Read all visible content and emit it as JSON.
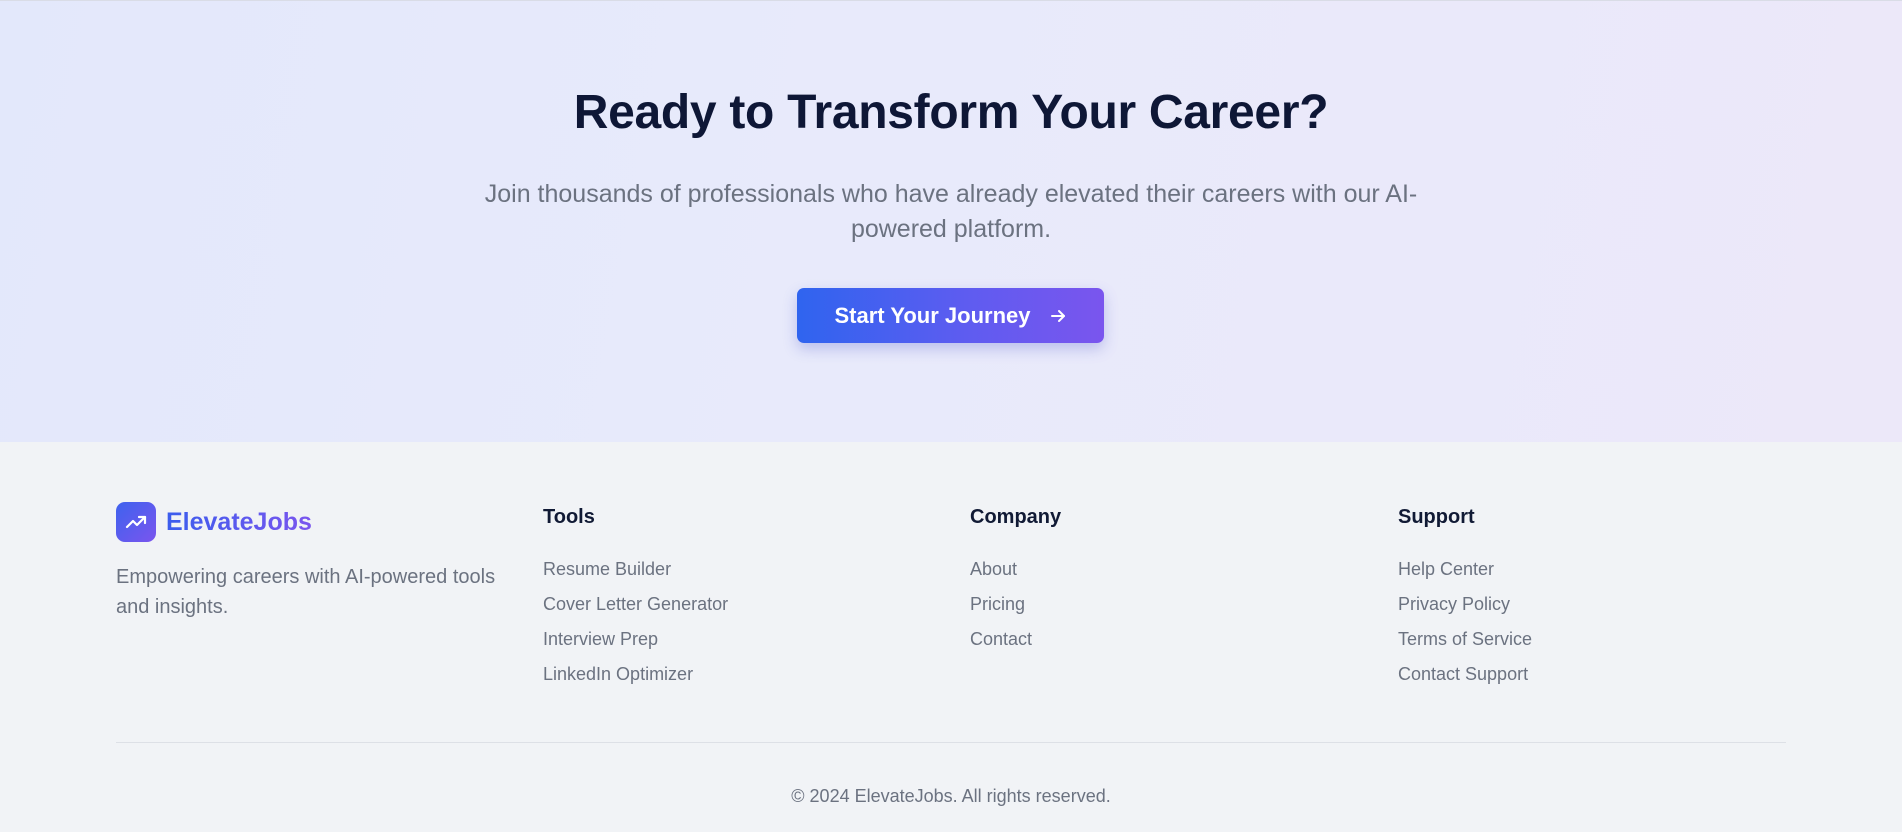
{
  "cta": {
    "title": "Ready to Transform Your Career?",
    "subtitle": "Join thousands of professionals who have already elevated their careers with our AI-powered platform.",
    "button_label": "Start Your Journey",
    "button_icon": "arrow-right-icon"
  },
  "footer": {
    "brand": {
      "name": "ElevateJobs",
      "logo_icon": "trending-up-icon",
      "tagline": "Empowering careers with AI-powered tools and insights."
    },
    "columns": [
      {
        "heading": "Tools",
        "links": [
          "Resume Builder",
          "Cover Letter Generator",
          "Interview Prep",
          "LinkedIn Optimizer"
        ]
      },
      {
        "heading": "Company",
        "links": [
          "About",
          "Pricing",
          "Contact"
        ]
      },
      {
        "heading": "Support",
        "links": [
          "Help Center",
          "Privacy Policy",
          "Terms of Service",
          "Contact Support"
        ]
      }
    ],
    "copyright": "© 2024 ElevateJobs. All rights reserved."
  },
  "colors": {
    "primary_blue": "#2f64ef",
    "primary_purple": "#7a55ee",
    "heading": "#0e1736",
    "muted_text": "#6b7280",
    "footer_bg": "#f1f3f6"
  }
}
